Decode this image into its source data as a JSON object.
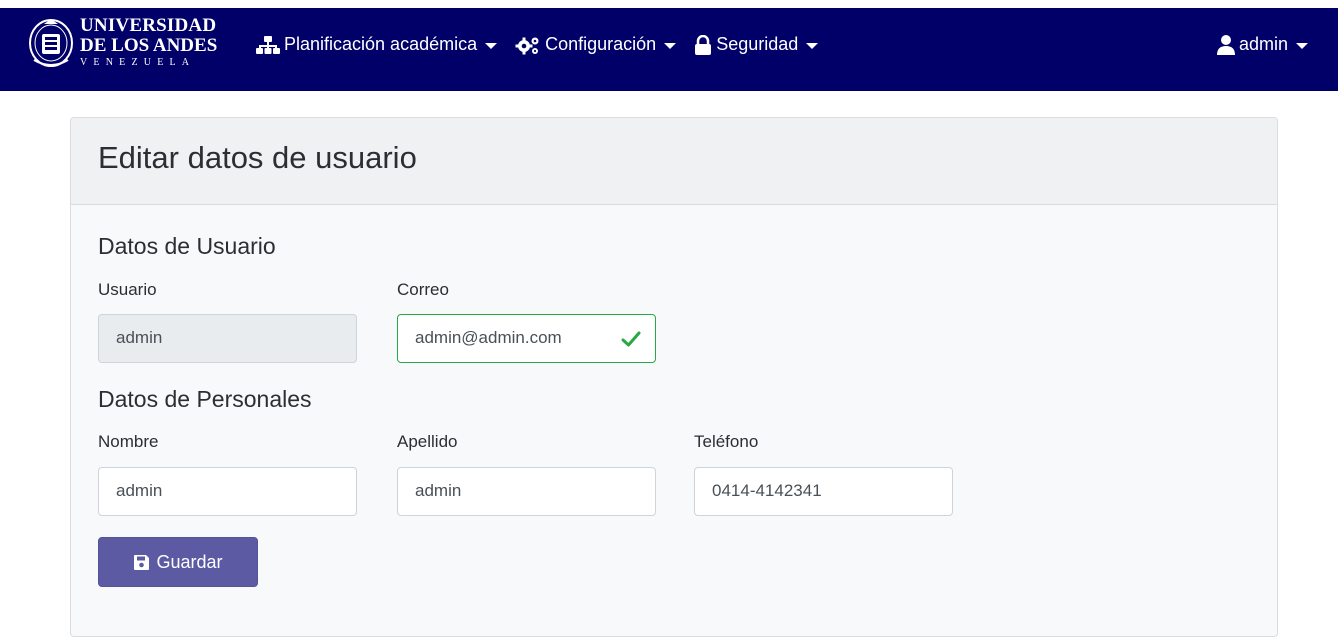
{
  "brand": {
    "line1": "UNIVERSIDAD",
    "line2": "DE LOS ANDES",
    "line3": "VENEZUELA",
    "seal_icon": "university-seal-icon"
  },
  "nav": {
    "items": [
      {
        "label": "Planificación académica",
        "icon": "sitemap-icon"
      },
      {
        "label": "Configuración",
        "icon": "cogs-icon"
      },
      {
        "label": "Seguridad",
        "icon": "lock-icon"
      }
    ],
    "user": {
      "label": "admin",
      "icon": "user-icon"
    }
  },
  "page": {
    "title": "Editar datos de usuario"
  },
  "user_section": {
    "title": "Datos de Usuario",
    "usuario_label": "Usuario",
    "usuario_value": "admin",
    "correo_label": "Correo",
    "correo_value": "admin@admin.com"
  },
  "personal_section": {
    "title": "Datos de Personales",
    "nombre_label": "Nombre",
    "nombre_value": "admin",
    "apellido_label": "Apellido",
    "apellido_value": "admin",
    "telefono_label": "Teléfono",
    "telefono_value": "0414-4142341"
  },
  "actions": {
    "save_label": "Guardar",
    "save_icon": "floppy-disk-icon"
  },
  "colors": {
    "navbar": "#000068",
    "primary_button": "#5b5aa3",
    "valid": "#28a745"
  }
}
